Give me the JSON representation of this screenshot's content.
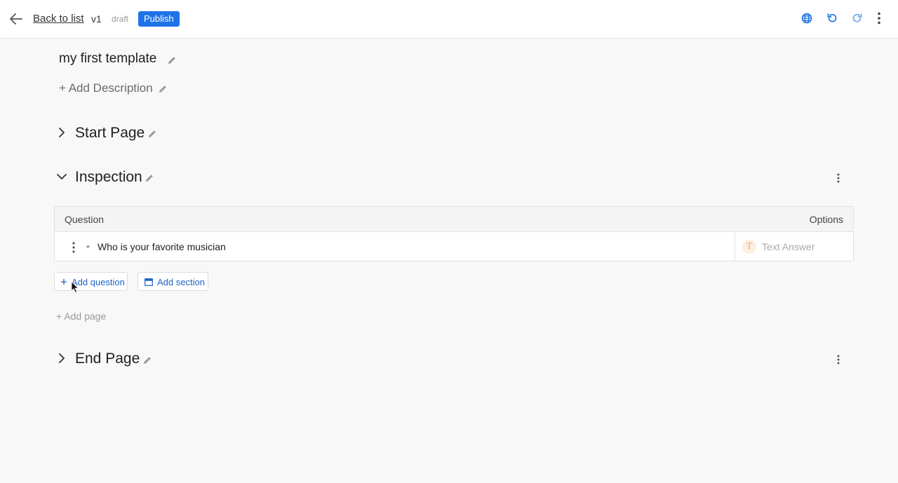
{
  "topbar": {
    "back_label": "Back to list",
    "version": "v1",
    "status": "draft",
    "publish_label": "Publish",
    "icons": [
      "globe-icon",
      "undo-icon",
      "redo-icon",
      "more-vertical-icon"
    ],
    "accent_color": "#1e73e8"
  },
  "template": {
    "title": "my first template",
    "add_description_label": "+ Add Description"
  },
  "sections": {
    "start_page": {
      "label": "Start Page",
      "expanded": false
    },
    "inspection": {
      "label": "Inspection",
      "expanded": true
    },
    "end_page": {
      "label": "End Page",
      "expanded": false
    }
  },
  "table": {
    "header_question": "Question",
    "header_options": "Options",
    "rows": [
      {
        "required_mark": "*",
        "question": "Who is your favorite musician",
        "type_badge": "T",
        "type_label": "Text Answer"
      }
    ]
  },
  "actions": {
    "add_question_label": "Add question",
    "add_section_label": "Add section",
    "add_page_label": "+ Add page"
  }
}
